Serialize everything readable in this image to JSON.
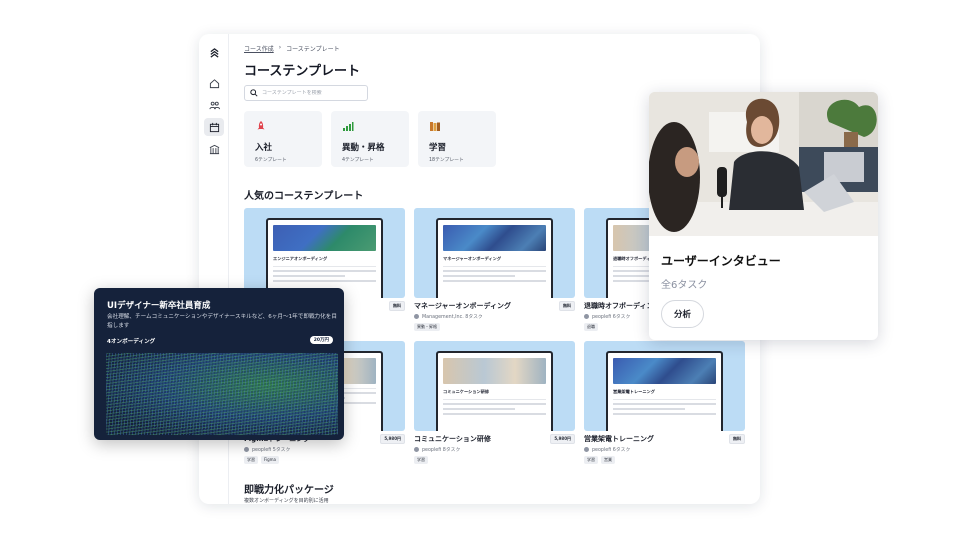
{
  "breadcrumb": {
    "parent": "コース作成",
    "separator": "›",
    "current": "コーステンプレート"
  },
  "page_title": "コーステンプレート",
  "search": {
    "placeholder": "コーステンプレートを検索"
  },
  "categories": [
    {
      "name": "入社",
      "count": "6テンプレート",
      "icon": "rocket-icon",
      "color": "#e0434c"
    },
    {
      "name": "異動・昇格",
      "count": "4テンプレート",
      "icon": "chart-bars-icon",
      "color": "#2f9a3d"
    },
    {
      "name": "学習",
      "count": "18テンプレート",
      "icon": "books-icon",
      "color": "#c8782a"
    }
  ],
  "popular": {
    "title": "人気のコーステンプレート",
    "cards": [
      {
        "doc_title": "エンジニアオンボーディング",
        "title": "",
        "badge": "無料",
        "sub": "",
        "tags": []
      },
      {
        "doc_title": "マネージャーオンボーディング",
        "title": "マネージャーオンボーディング",
        "badge": "無料",
        "sub": "Management,Inc. 8タスク",
        "tags": [
          "異動・昇格"
        ]
      },
      {
        "doc_title": "退職時オフボーディング",
        "title": "退職時オフボーディング",
        "badge": "",
        "sub": "peoplefi 6タスク",
        "tags": [
          "退職"
        ]
      },
      {
        "doc_title": "",
        "title": "Figmaトレーニング",
        "badge": "5,980円",
        "sub": "peoplefi 5タスク",
        "tags": [
          "学習",
          "Figma"
        ]
      },
      {
        "doc_title": "コミュニケーション研修",
        "title": "コミュニケーション研修",
        "badge": "5,980円",
        "sub": "peoplefi 8タスク",
        "tags": [
          "学習"
        ]
      },
      {
        "doc_title": "営業架電トレーニング",
        "title": "営業架電トレーニング",
        "badge": "無料",
        "sub": "peoplefi 6タスク",
        "tags": [
          "学習",
          "営業"
        ]
      }
    ]
  },
  "package": {
    "title": "即戦力化パッケージ",
    "subtitle": "複数オンボーディングを目的別に活用"
  },
  "featured_dark": {
    "title": "UIデザイナー新卒社員育成",
    "description": "会社理解、チームコミュニケーションやデザイナースキルなど、6ヶ月〜1年で即戦力化を目指します",
    "count": "4オンボーディング",
    "price": "20万円"
  },
  "interview": {
    "title": "ユーザーインタビュー",
    "subtitle": "全6タスク",
    "button": "分析"
  },
  "colors": {
    "accent_blue": "#bcdcf5",
    "dark_card": "#15223b"
  }
}
